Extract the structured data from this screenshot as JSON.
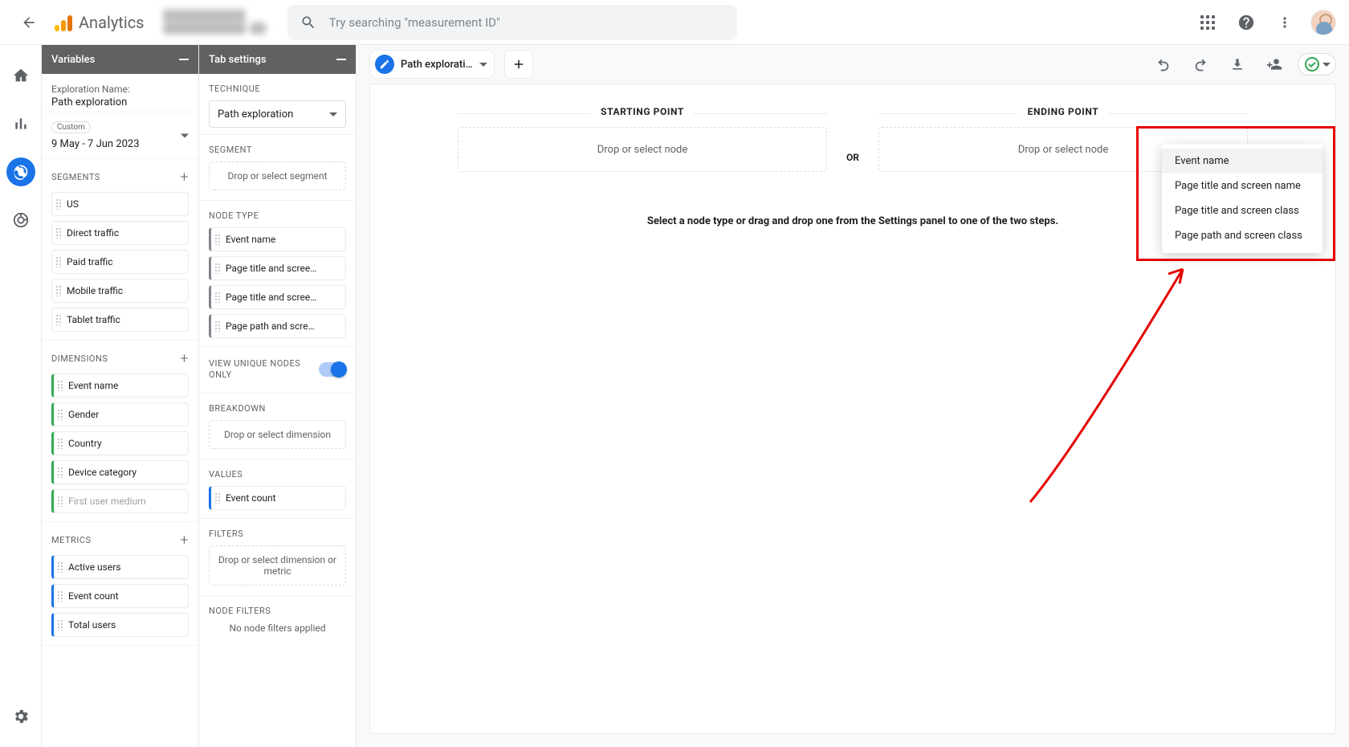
{
  "app": {
    "title": "Analytics"
  },
  "search": {
    "placeholder": "Try searching \"measurement ID\""
  },
  "panels": {
    "variables": {
      "title": "Variables"
    },
    "tabSettings": {
      "title": "Tab settings"
    }
  },
  "exploration": {
    "name_label": "Exploration Name:",
    "name_value": "Path exploration",
    "date_badge": "Custom",
    "date_range": "9 May - 7 Jun 2023"
  },
  "segments": {
    "heading": "SEGMENTS",
    "items": [
      "US",
      "Direct traffic",
      "Paid traffic",
      "Mobile traffic",
      "Tablet traffic"
    ]
  },
  "dimensions": {
    "heading": "DIMENSIONS",
    "items": [
      "Event name",
      "Gender",
      "Country",
      "Device category"
    ],
    "ghost_items": [
      "First user medium"
    ]
  },
  "metrics": {
    "heading": "METRICS",
    "items": [
      "Active users",
      "Event count",
      "Total users"
    ]
  },
  "technique": {
    "heading": "TECHNIQUE",
    "value": "Path exploration"
  },
  "segment_slot": {
    "heading": "SEGMENT",
    "placeholder": "Drop or select segment"
  },
  "node_type": {
    "heading": "NODE TYPE",
    "items": [
      "Event name",
      "Page title and scree…",
      "Page title and scree…",
      "Page path and scre…"
    ]
  },
  "unique_nodes": {
    "heading": "VIEW UNIQUE NODES ONLY"
  },
  "breakdown": {
    "heading": "BREAKDOWN",
    "placeholder": "Drop or select dimension"
  },
  "values": {
    "heading": "VALUES",
    "items": [
      "Event count"
    ]
  },
  "filters": {
    "heading": "FILTERS",
    "placeholder": "Drop or select dimension or metric"
  },
  "node_filters": {
    "heading": "NODE FILTERS",
    "note": "No node filters applied"
  },
  "doc_tab": {
    "name": "Path explorati…"
  },
  "canvas": {
    "starting": {
      "heading": "STARTING POINT",
      "placeholder": "Drop or select node"
    },
    "ending": {
      "heading": "ENDING POINT",
      "placeholder": "Drop or select node"
    },
    "or": "OR",
    "hint": "Select a node type or drag and drop one from the Settings panel to one of the two steps."
  },
  "node_menu": {
    "items": [
      "Event name",
      "Page title and screen name",
      "Page title and screen class",
      "Page path and screen class"
    ]
  }
}
